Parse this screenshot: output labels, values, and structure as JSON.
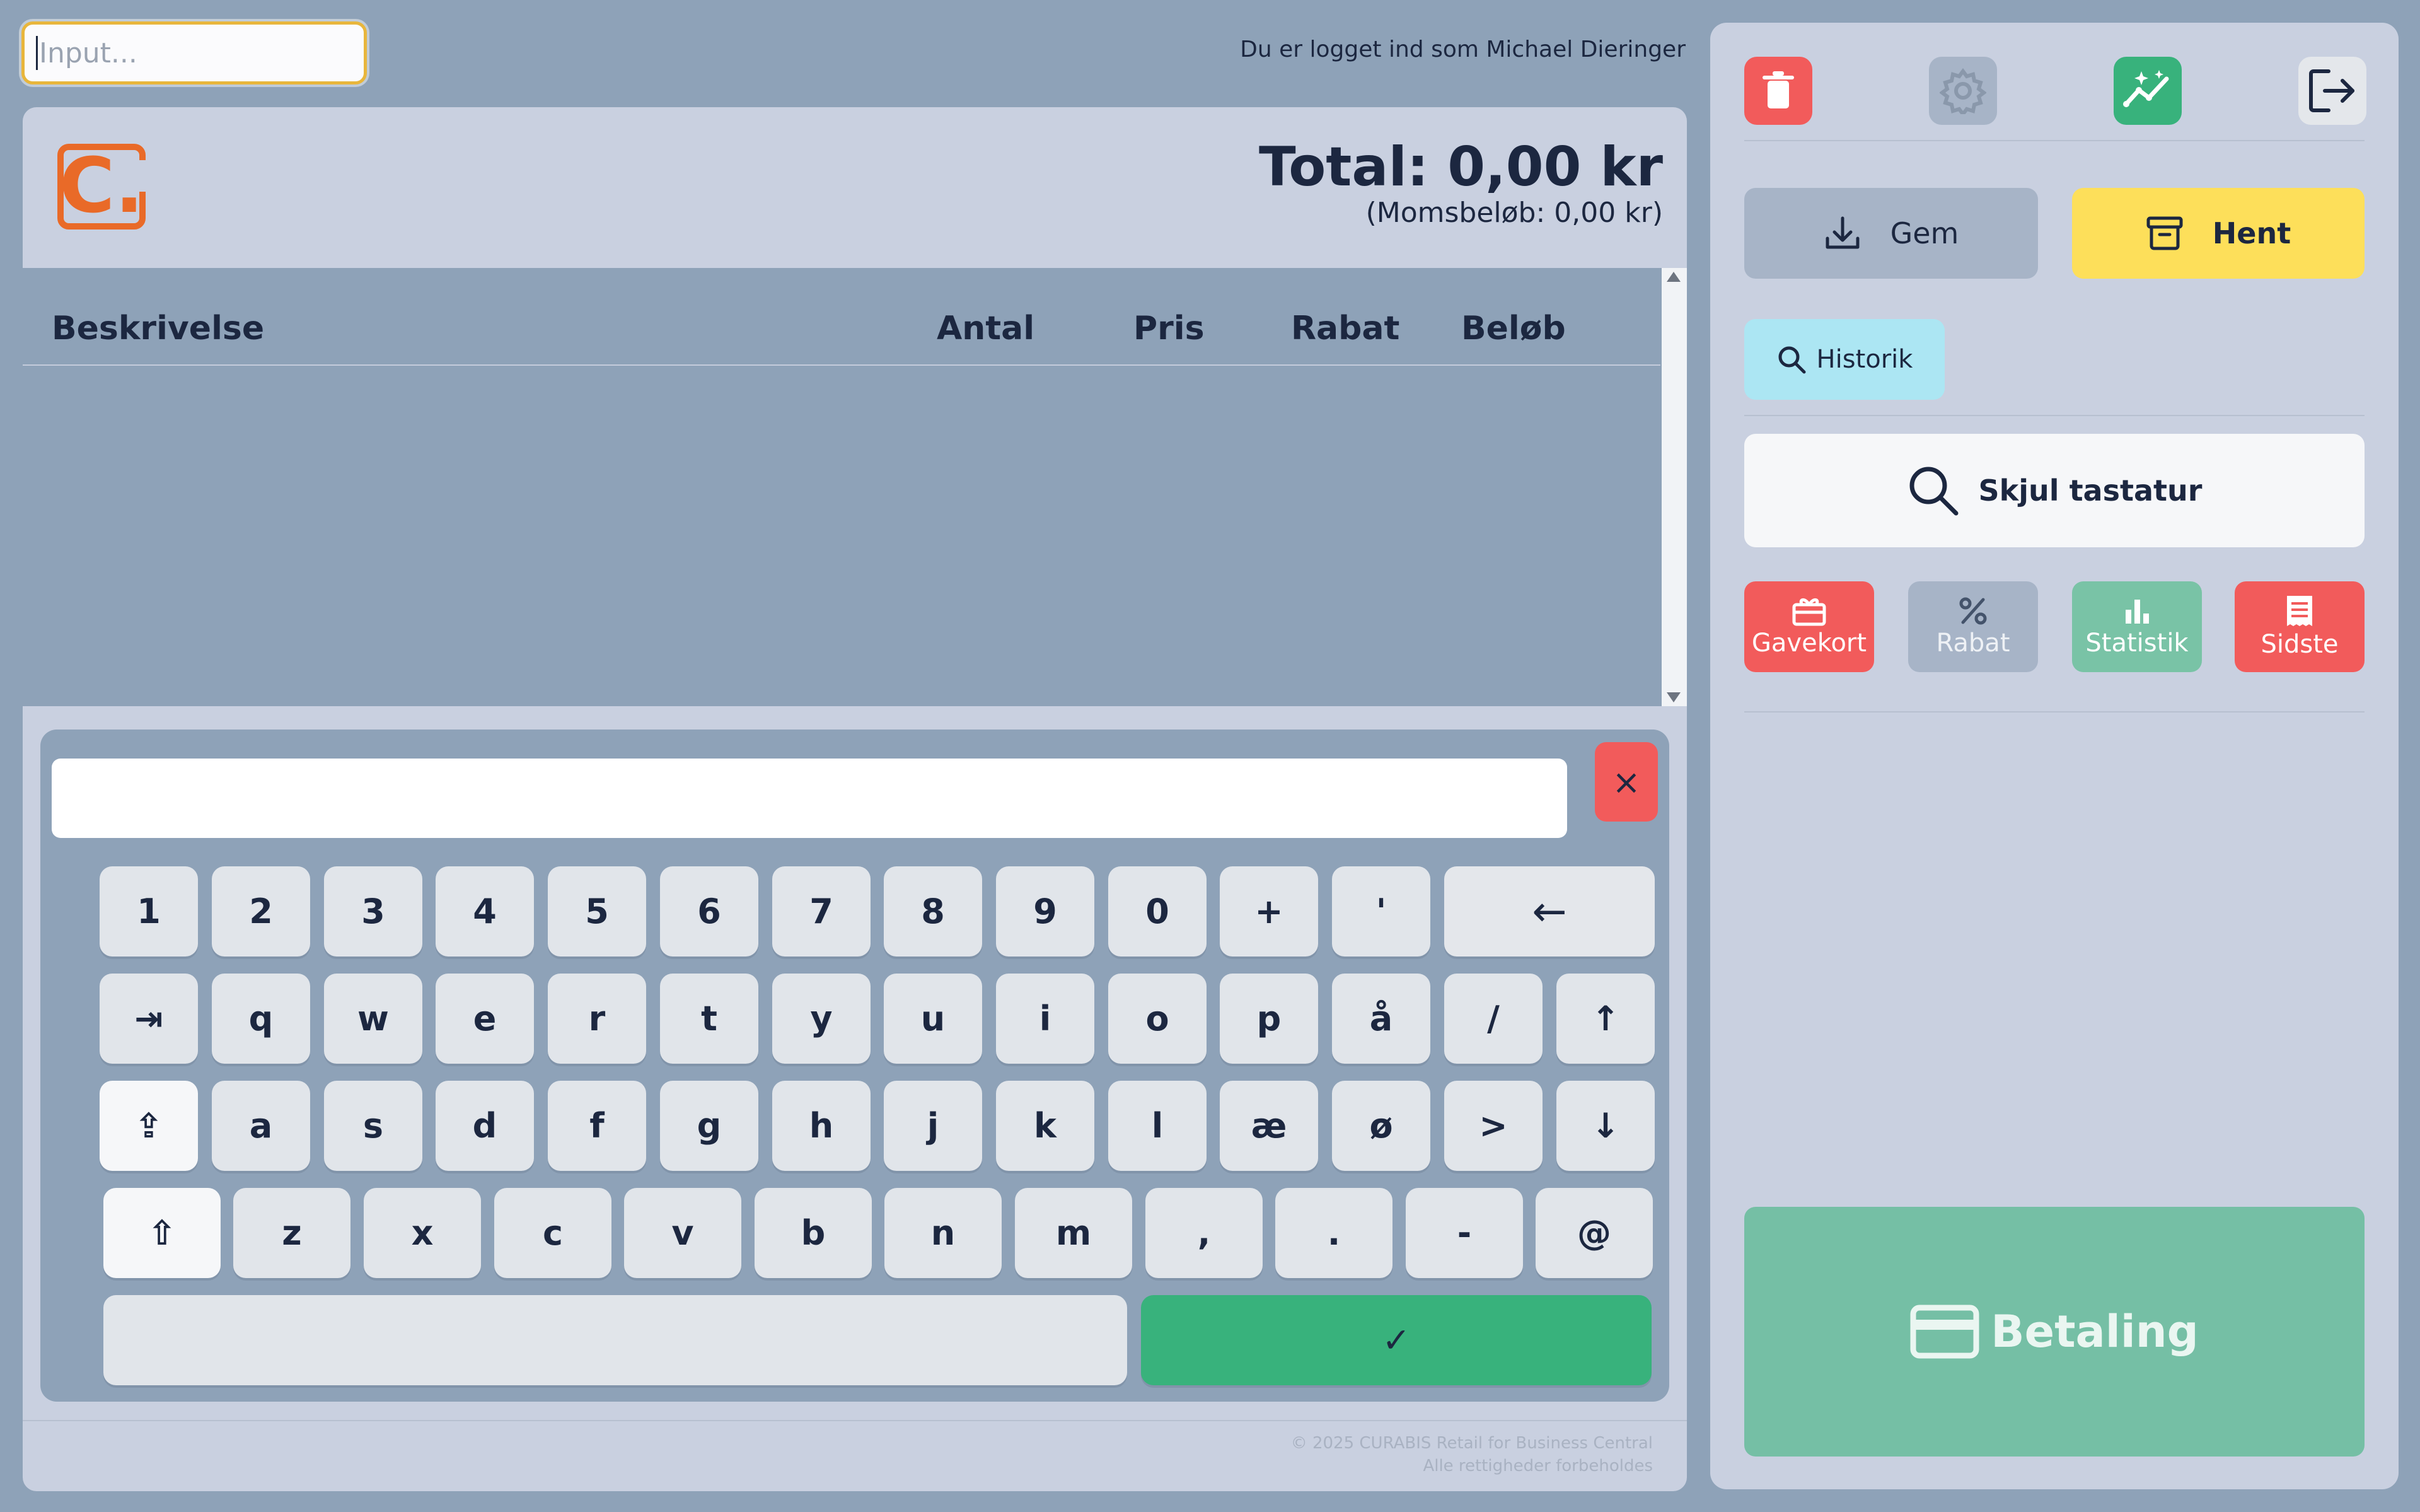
{
  "search": {
    "placeholder": "Input..."
  },
  "session": {
    "login_text": "Du er logget ind som Michael Dieringer"
  },
  "logo": {
    "text": "C."
  },
  "totals": {
    "total": "Total: 0,00 kr",
    "vat": "(Momsbeløb: 0,00 kr)"
  },
  "table": {
    "columns": [
      "Beskrivelse",
      "Antal",
      "Pris",
      "Rabat",
      "Beløb"
    ],
    "rows": []
  },
  "keyboard": {
    "input_value": "",
    "close_symbol": "×",
    "rows": [
      [
        "1",
        "2",
        "3",
        "4",
        "5",
        "6",
        "7",
        "8",
        "9",
        "0",
        "+",
        "'",
        "←"
      ],
      [
        "⇥",
        "q",
        "w",
        "e",
        "r",
        "t",
        "y",
        "u",
        "i",
        "o",
        "p",
        "å",
        "/",
        "↑"
      ],
      [
        "⇪",
        "a",
        "s",
        "d",
        "f",
        "g",
        "h",
        "j",
        "k",
        "l",
        "æ",
        "ø",
        ">",
        "↓"
      ],
      [
        "⇧",
        "z",
        "x",
        "c",
        "v",
        "b",
        "n",
        "m",
        ",",
        ".",
        "-",
        "@"
      ]
    ],
    "space_label": "",
    "enter_label": "✓"
  },
  "footer": {
    "copyright": "© 2025 CURABIS Retail for Business Central",
    "rights": "Alle rettigheder forbeholdes"
  },
  "right_panel": {
    "top_icons": [
      {
        "name": "trash-icon",
        "color": "#f25b5b"
      },
      {
        "name": "gear-icon",
        "color": "#a7b4c7"
      },
      {
        "name": "analytics-icon",
        "color": "#38b27c"
      },
      {
        "name": "logout-icon",
        "color": "#e4e7eb"
      }
    ],
    "save_label": "Gem",
    "fetch_label": "Hent",
    "history_label": "Historik",
    "hide_keyboard_label": "Skjul tastatur",
    "functions": [
      {
        "label": "Gavekort",
        "color": "#f25b5b",
        "icon": "gift-card-icon"
      },
      {
        "label": "Rabat",
        "color": "#a7b4c7",
        "icon": "percent-icon"
      },
      {
        "label": "Statistik",
        "color": "#79c3a6",
        "icon": "bar-chart-icon"
      },
      {
        "label": "Sidste",
        "color": "#f25b5b",
        "icon": "receipt-icon"
      }
    ],
    "payment_label": "Betaling"
  },
  "colors": {
    "background": "#8ea2b8",
    "panel": "#c9d0e0",
    "accent_yellow": "#fddf5a",
    "accent_cyan": "#ace6f3",
    "accent_green": "#38b27c",
    "payment_green": "#75bfa5",
    "danger_red": "#f25b5b",
    "logo_orange": "#e96a28"
  }
}
